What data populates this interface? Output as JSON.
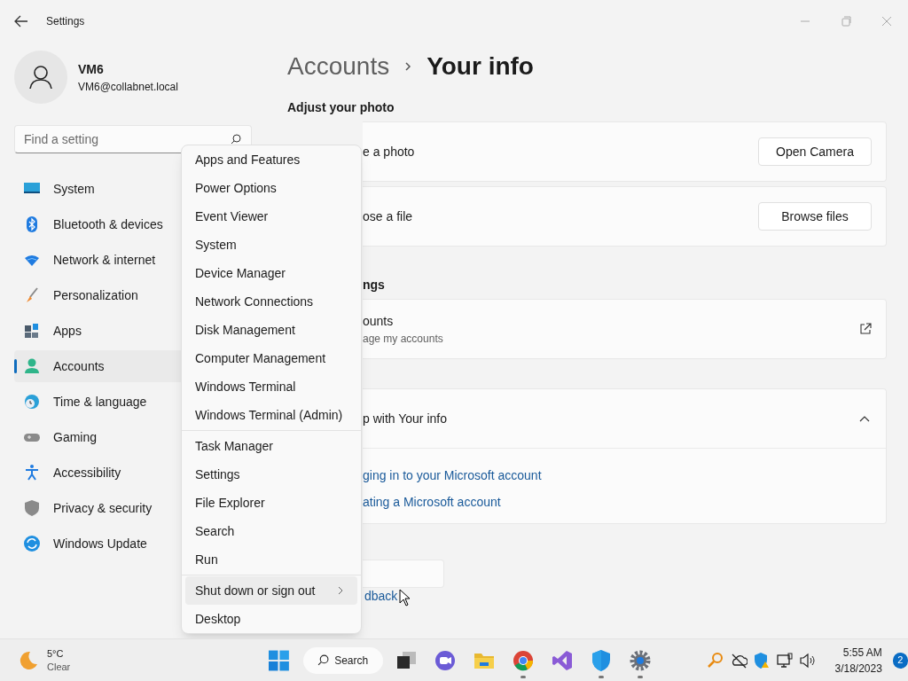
{
  "window": {
    "title": "Settings"
  },
  "user": {
    "name": "VM6",
    "email": "VM6@collabnet.local"
  },
  "search": {
    "placeholder": "Find a setting"
  },
  "nav": [
    {
      "label": "System",
      "kind": "system",
      "selected": false
    },
    {
      "label": "Bluetooth & devices",
      "kind": "bluetooth",
      "selected": false
    },
    {
      "label": "Network & internet",
      "kind": "network",
      "selected": false
    },
    {
      "label": "Personalization",
      "kind": "brush",
      "selected": false
    },
    {
      "label": "Apps",
      "kind": "apps",
      "selected": false
    },
    {
      "label": "Accounts",
      "kind": "accounts",
      "selected": true
    },
    {
      "label": "Time & language",
      "kind": "time",
      "selected": false
    },
    {
      "label": "Gaming",
      "kind": "gaming",
      "selected": false
    },
    {
      "label": "Accessibility",
      "kind": "accessibility",
      "selected": false
    },
    {
      "label": "Privacy & security",
      "kind": "privacy",
      "selected": false
    },
    {
      "label": "Windows Update",
      "kind": "update",
      "selected": false
    }
  ],
  "breadcrumb": {
    "parent": "Accounts",
    "current": "Your info"
  },
  "photo_section": {
    "heading": "Adjust your photo",
    "rows": [
      {
        "label": "e a photo",
        "button": "Open Camera"
      },
      {
        "label": "ose a file",
        "button": "Browse files"
      }
    ]
  },
  "related_section": {
    "heading": "ngs",
    "card": {
      "title": "ounts",
      "subtitle": "age my accounts"
    }
  },
  "help_card": {
    "title": "p with Your info",
    "expanded": true,
    "links": [
      "ging in to your Microsoft account",
      "ating a Microsoft account"
    ]
  },
  "feedback_link": "dback",
  "context_menu": {
    "groups": [
      [
        {
          "label": "Apps and Features",
          "selected": false,
          "submenu": false
        },
        {
          "label": "Power Options",
          "selected": false,
          "submenu": false
        },
        {
          "label": "Event Viewer",
          "selected": false,
          "submenu": false
        },
        {
          "label": "System",
          "selected": false,
          "submenu": false
        },
        {
          "label": "Device Manager",
          "selected": false,
          "submenu": false
        },
        {
          "label": "Network Connections",
          "selected": false,
          "submenu": false
        },
        {
          "label": "Disk Management",
          "selected": false,
          "submenu": false
        },
        {
          "label": "Computer Management",
          "selected": false,
          "submenu": false
        },
        {
          "label": "Windows Terminal",
          "selected": false,
          "submenu": false
        },
        {
          "label": "Windows Terminal (Admin)",
          "selected": false,
          "submenu": false
        }
      ],
      [
        {
          "label": "Task Manager",
          "selected": false,
          "submenu": false
        },
        {
          "label": "Settings",
          "selected": false,
          "submenu": false
        },
        {
          "label": "File Explorer",
          "selected": false,
          "submenu": false
        },
        {
          "label": "Search",
          "selected": false,
          "submenu": false
        },
        {
          "label": "Run",
          "selected": false,
          "submenu": false
        }
      ],
      [
        {
          "label": "Shut down or sign out",
          "selected": true,
          "submenu": true
        },
        {
          "label": "Desktop",
          "selected": false,
          "submenu": false
        }
      ]
    ]
  },
  "taskbar": {
    "weather": {
      "temperature": "5°C",
      "condition": "Clear"
    },
    "search_label": "Search",
    "apps": [
      {
        "kind": "taskview",
        "running": false
      },
      {
        "kind": "chat",
        "running": false
      },
      {
        "kind": "folder",
        "running": false
      },
      {
        "kind": "browser",
        "running": true
      },
      {
        "kind": "studio",
        "running": false
      },
      {
        "kind": "shield",
        "running": true
      },
      {
        "kind": "gear",
        "running": true
      }
    ],
    "tray": [
      {
        "kind": "key"
      },
      {
        "kind": "cloud"
      },
      {
        "kind": "shield-warning"
      },
      {
        "kind": "network"
      },
      {
        "kind": "volume"
      }
    ],
    "time": "5:55 AM",
    "date": "3/18/2023",
    "notifications": "2"
  }
}
